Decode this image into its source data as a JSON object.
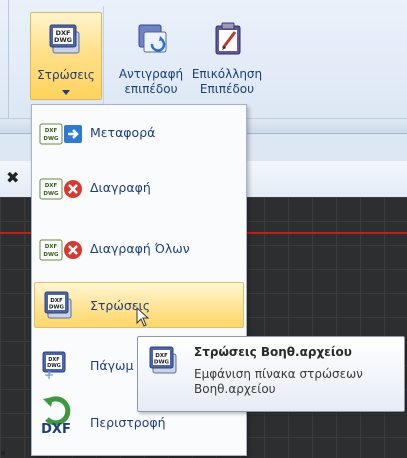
{
  "ribbon": {
    "layers_button": {
      "label": "Στρώσεις",
      "icon": "dxf-dwg-layers-icon"
    },
    "copy_layer_button": {
      "line1": "Αντιγραφή",
      "line2": "επιπέδου",
      "icon": "copy-layer-icon"
    },
    "paste_layer_button": {
      "line1": "Επικόλληση",
      "line2": "Επιπέδου",
      "icon": "paste-layer-icon"
    }
  },
  "menu": {
    "items": [
      {
        "label": "Μεταφορά",
        "icon": "dxf-dwg-move-icon"
      },
      {
        "label": "Διαγραφή",
        "icon": "dxf-dwg-delete-icon"
      },
      {
        "label": "Διαγραφή Όλων",
        "icon": "dxf-dwg-delete-all-icon"
      },
      {
        "label": "Στρώσεις",
        "icon": "dxf-dwg-layers-icon",
        "highlighted": true
      },
      {
        "label": "Πάγωμ",
        "icon": "dxf-dwg-freeze-icon"
      },
      {
        "label": "Περιστροφή",
        "icon": "dxf-rotate-icon"
      }
    ]
  },
  "tooltip": {
    "title": "Στρώσεις Βοηθ.αρχείου",
    "desc_line1": "Εμφάνιση πίνακα στρώσεων",
    "desc_line2": "Βοηθ.αρχείου",
    "icon": "dxf-dwg-layers-icon"
  },
  "toolbar": {
    "close_glyph": "✖"
  },
  "icons": {
    "dxf": "DXF",
    "dwg": "DWG"
  },
  "colors": {
    "menu_text": "#1d3f7f",
    "highlight": "#ffe08a",
    "canvas": "#2d2e30",
    "canvas_line": "#c0201a"
  }
}
